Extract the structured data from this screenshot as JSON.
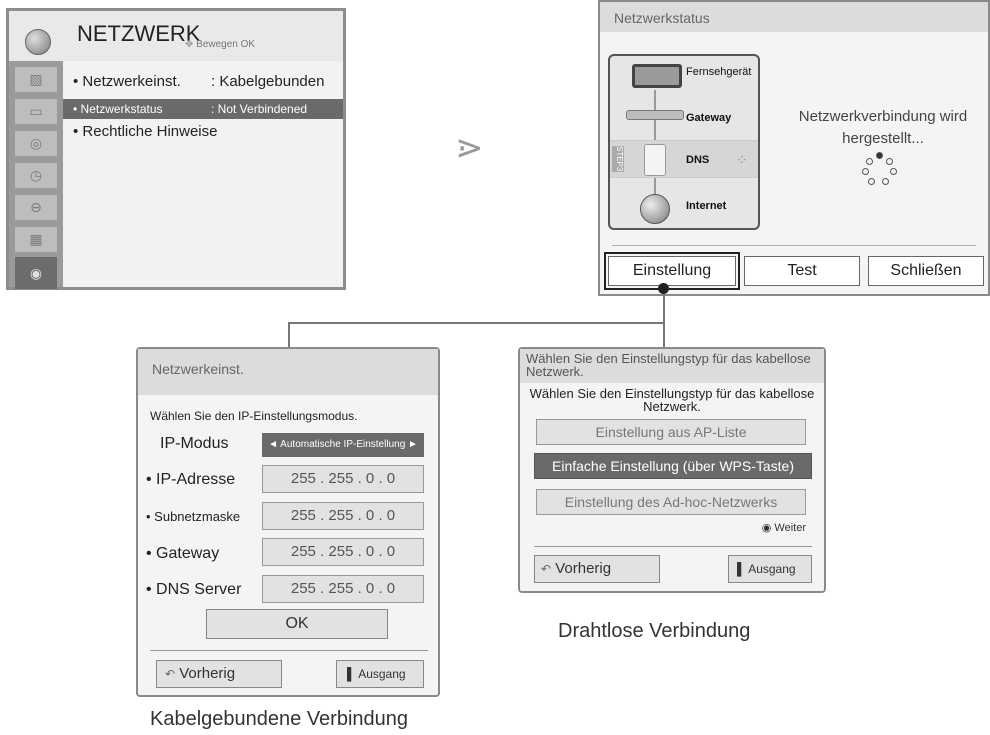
{
  "menu": {
    "title": "NETZWERK",
    "nav_hint": "Bewegen   OK",
    "sidebar_icons": [
      "picture-icon",
      "screen-icon",
      "audio-icon",
      "clock-icon",
      "lock-icon",
      "option-icon",
      "network-icon"
    ],
    "items": [
      {
        "label": "• Netzwerkeinst.",
        "value": ": Kabelgebunden"
      },
      {
        "label": "• Netzwerkstatus",
        "value": ": Not Verbindened"
      },
      {
        "label": "• Rechtliche Hinweise",
        "value": ""
      }
    ]
  },
  "arrow": "⋗",
  "status": {
    "title": "Netzwerkstatus",
    "nodes": [
      "Fernsehgerät",
      "Gateway",
      "DNS",
      "Internet"
    ],
    "step_label": "STEP3",
    "message": "Netzwerkverbindung wird hergestellt...",
    "buttons": [
      "Einstellung",
      "Test",
      "Schließen"
    ]
  },
  "wired": {
    "title": "Netzwerkeinst.",
    "hint": "Wählen Sie den IP-Einstellungsmodus.",
    "mode_label": "IP-Modus",
    "mode_value": "◄ Automatische IP-Einstellung ►",
    "fields": [
      {
        "label": "• IP-Adresse",
        "value": "255 . 255 . 0 . 0"
      },
      {
        "label": "• Subnetzmaske",
        "value": "255 . 255 . 0 . 0"
      },
      {
        "label": "• Gateway",
        "value": "255 . 255 . 0 . 0"
      },
      {
        "label": "• DNS Server",
        "value": "255 . 255 . 0 . 0"
      }
    ],
    "ok": "OK",
    "prev": "Vorherig",
    "exit": "Ausgang"
  },
  "wifi": {
    "title": "Wählen Sie den Einstellungstyp für das kabellose Netzwerk.",
    "subtitle": "Wählen Sie den Einstellungstyp für das kabellose Netzwerk.",
    "options": [
      "Einstellung aus AP-Liste",
      "Einfache Einstellung (über WPS-Taste)",
      "Einstellung des Ad-hoc-Netzwerks"
    ],
    "next": "◉ Weiter",
    "prev": "Vorherig",
    "exit": "Ausgang"
  },
  "captions": {
    "wired": "Kabelgebundene Verbindung",
    "wireless": "Drahtlose Verbindung"
  }
}
